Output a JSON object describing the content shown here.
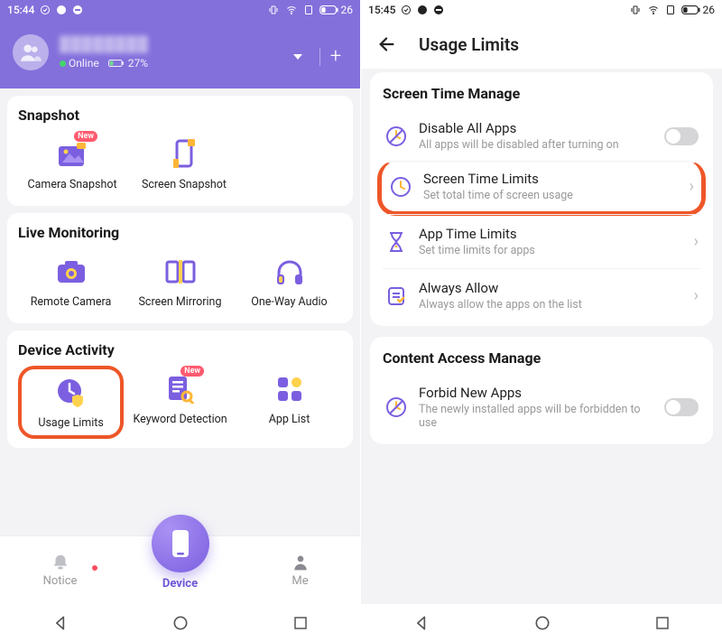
{
  "colors": {
    "accent": "#8470db",
    "accent_dark": "#6f56d6",
    "highlight": "#ee5628",
    "badge": "#ff5a6e",
    "online": "#42d66b"
  },
  "left": {
    "status": {
      "time": "15:44",
      "battery": "26"
    },
    "header": {
      "name": "████████",
      "online_label": "Online",
      "battery_pct": "27%"
    },
    "sections": [
      {
        "title": "Snapshot",
        "tiles": [
          {
            "id": "camera-snapshot",
            "label": "Camera Snapshot",
            "icon": "photo-icon",
            "badge": "New"
          },
          {
            "id": "screen-snapshot",
            "label": "Screen Snapshot",
            "icon": "screencap-icon"
          }
        ]
      },
      {
        "title": "Live Monitoring",
        "tiles": [
          {
            "id": "remote-camera",
            "label": "Remote Camera",
            "icon": "camera-icon"
          },
          {
            "id": "screen-mirroring",
            "label": "Screen Mirroring",
            "icon": "mirror-icon"
          },
          {
            "id": "one-way-audio",
            "label": "One-Way Audio",
            "icon": "headphones-icon"
          }
        ]
      },
      {
        "title": "Device Activity",
        "tiles": [
          {
            "id": "usage-limits",
            "label": "Usage Limits",
            "icon": "clock-shield-icon",
            "highlight": true
          },
          {
            "id": "keyword-detection",
            "label": "Keyword Detection",
            "icon": "doc-search-icon",
            "badge": "New"
          },
          {
            "id": "app-list",
            "label": "App List",
            "icon": "grid-icon"
          }
        ]
      }
    ],
    "tabs": {
      "notice": "Notice",
      "device": "Device",
      "me": "Me"
    }
  },
  "right": {
    "status": {
      "time": "15:45",
      "battery": "26"
    },
    "title": "Usage Limits",
    "groups": [
      {
        "heading": "Screen Time Manage",
        "items": [
          {
            "id": "disable-all-apps",
            "icon": "clock-slash-icon",
            "title": "Disable All Apps",
            "sub": "All apps will be disabled after turning on",
            "toggle": true
          },
          {
            "id": "screen-time-limits",
            "icon": "clock-icon",
            "title": "Screen Time Limits",
            "sub": "Set total time of screen usage",
            "chevron": true,
            "highlight": true
          },
          {
            "id": "app-time-limits",
            "icon": "hourglass-icon",
            "title": "App Time Limits",
            "sub": "Set time limits for apps",
            "chevron": true
          },
          {
            "id": "always-allow",
            "icon": "checklist-icon",
            "title": "Always Allow",
            "sub": "Always allow the apps on the list",
            "chevron": true
          }
        ]
      },
      {
        "heading": "Content Access Manage",
        "items": [
          {
            "id": "forbid-new-apps",
            "icon": "clock-slash-icon",
            "title": "Forbid New Apps",
            "sub": "The newly installed apps will be forbidden to use",
            "toggle": true
          }
        ]
      }
    ]
  }
}
